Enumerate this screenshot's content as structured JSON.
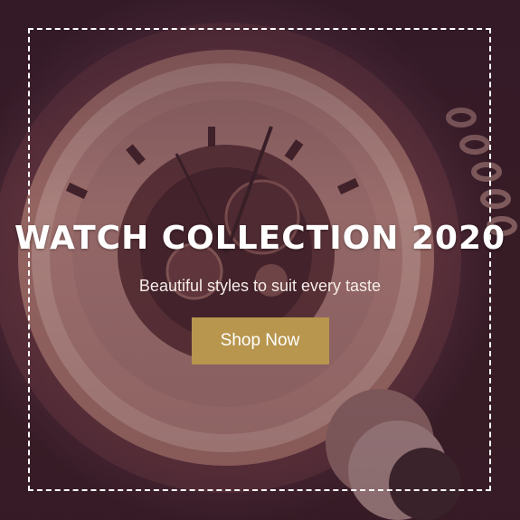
{
  "banner": {
    "title": "WATCH COLLECTION 2020",
    "subtitle": "Beautiful styles to suit every taste",
    "cta_label": "Shop Now"
  },
  "colors": {
    "cta_background": "#b8964e",
    "frame_border": "#ffffff",
    "text": "#ffffff"
  },
  "background_image": "pocket-watch-photo"
}
